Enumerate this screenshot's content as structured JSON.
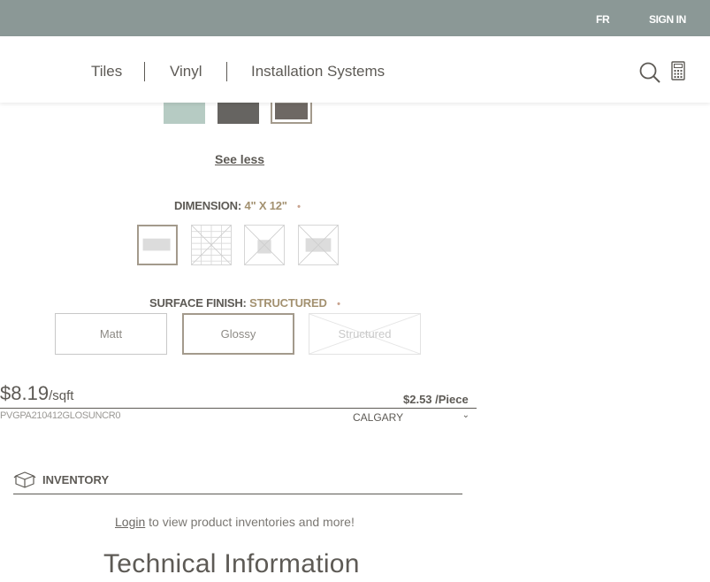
{
  "topbar": {
    "language": "FR",
    "sign_in": "SIGN IN"
  },
  "nav": {
    "items": [
      "Tiles",
      "Vinyl",
      "Installation Systems"
    ],
    "icons": [
      "search-icon",
      "calculator-icon"
    ]
  },
  "colors": {
    "swatches": [
      "#b6cbc3",
      "#666461",
      "#6e6864"
    ],
    "selected_index": 2,
    "see_less": "See less"
  },
  "dimension": {
    "label": "DIMENSION:",
    "value": "4\" X 12\"",
    "required_dot": "•",
    "selected_index": 0
  },
  "surface_finish": {
    "label": "SURFACE FINISH:",
    "value": "STRUCTURED",
    "required_dot": "•",
    "options": [
      "Matt",
      "Glossy",
      "Structured"
    ],
    "selected_index": 1,
    "unavailable_index": 2
  },
  "pricing": {
    "price": "$8.19",
    "unit": "/sqft",
    "piece_price": "$2.53 /Piece",
    "sku": "PVGPA210412GLOSUNCR0",
    "location": "CALGARY"
  },
  "inventory": {
    "label": "INVENTORY",
    "login_link": "Login",
    "login_text": " to view product inventories and more!"
  },
  "technical": {
    "title": "Technical Information"
  }
}
